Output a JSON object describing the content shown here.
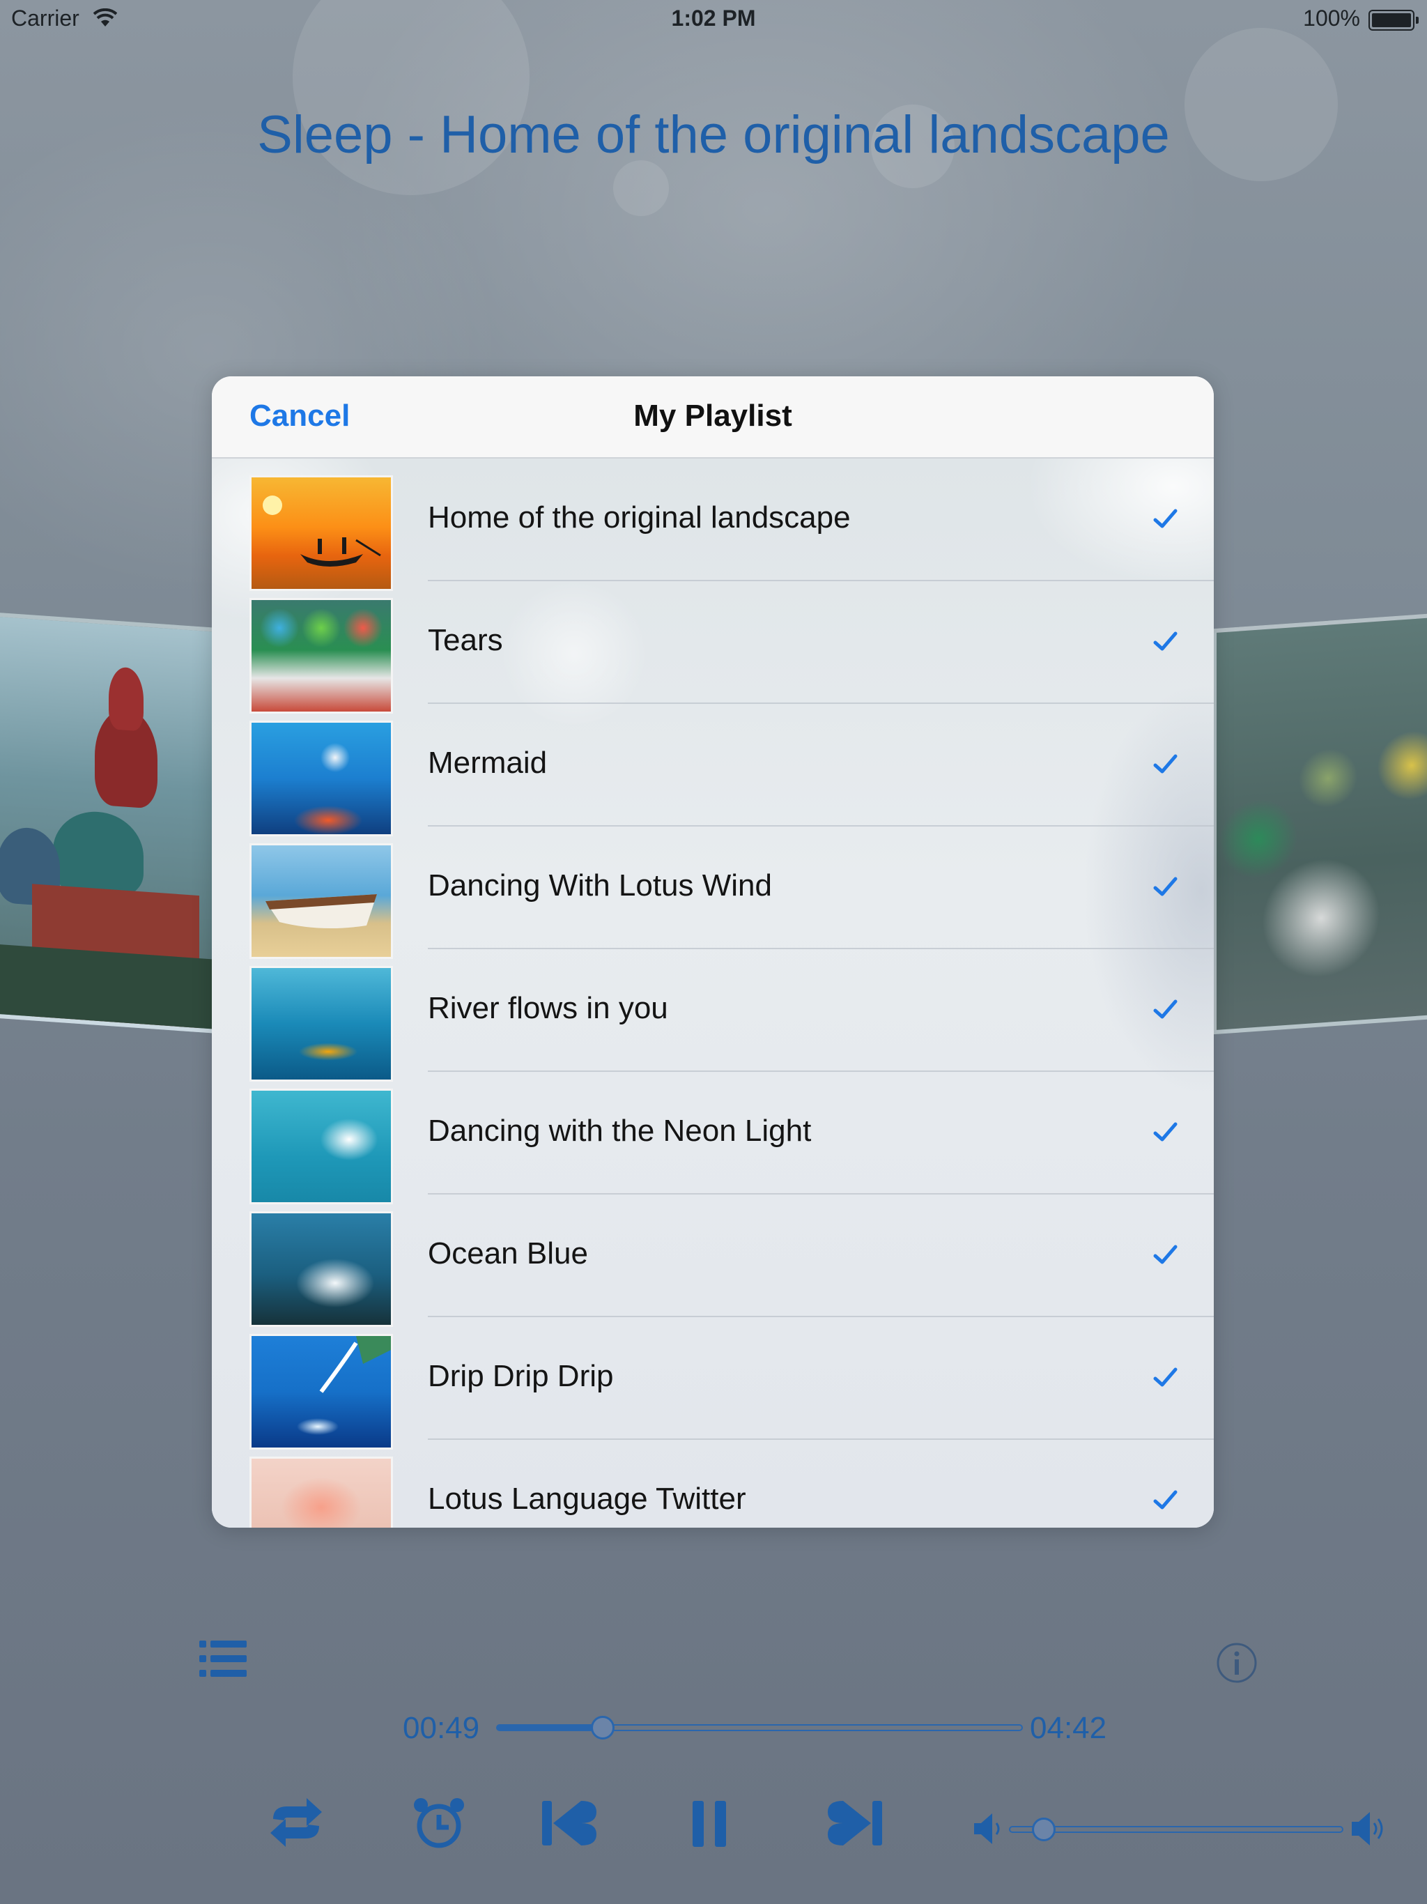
{
  "status_bar": {
    "carrier": "Carrier",
    "time": "1:02 PM",
    "battery": "100%"
  },
  "now_playing": {
    "title": "Sleep - Home of the original landscape",
    "elapsed": "00:49",
    "total": "04:42",
    "progress_fraction": 0.2,
    "volume_fraction": 0.1
  },
  "modal": {
    "cancel_label": "Cancel",
    "title": "My Playlist"
  },
  "playlist": [
    {
      "title": "Home of the original landscape",
      "checked": true
    },
    {
      "title": "Tears",
      "checked": true
    },
    {
      "title": "Mermaid",
      "checked": true
    },
    {
      "title": "Dancing With Lotus Wind",
      "checked": true
    },
    {
      "title": "River flows in you",
      "checked": true
    },
    {
      "title": "Dancing with the Neon Light",
      "checked": true
    },
    {
      "title": "Ocean Blue",
      "checked": true
    },
    {
      "title": "Drip Drip Drip",
      "checked": true
    },
    {
      "title": "Lotus Language Twitter",
      "checked": true
    }
  ],
  "colors": {
    "accent": "#1e78e6",
    "player_blue": "#1f5fa8"
  },
  "icons": {
    "playlist": "list-icon",
    "info": "info-icon",
    "repeat": "repeat-icon",
    "alarm": "alarm-clock-icon",
    "previous": "previous-track-icon",
    "pause": "pause-icon",
    "next": "next-track-icon",
    "volume_low": "volume-low-icon",
    "volume_high": "volume-high-icon"
  }
}
